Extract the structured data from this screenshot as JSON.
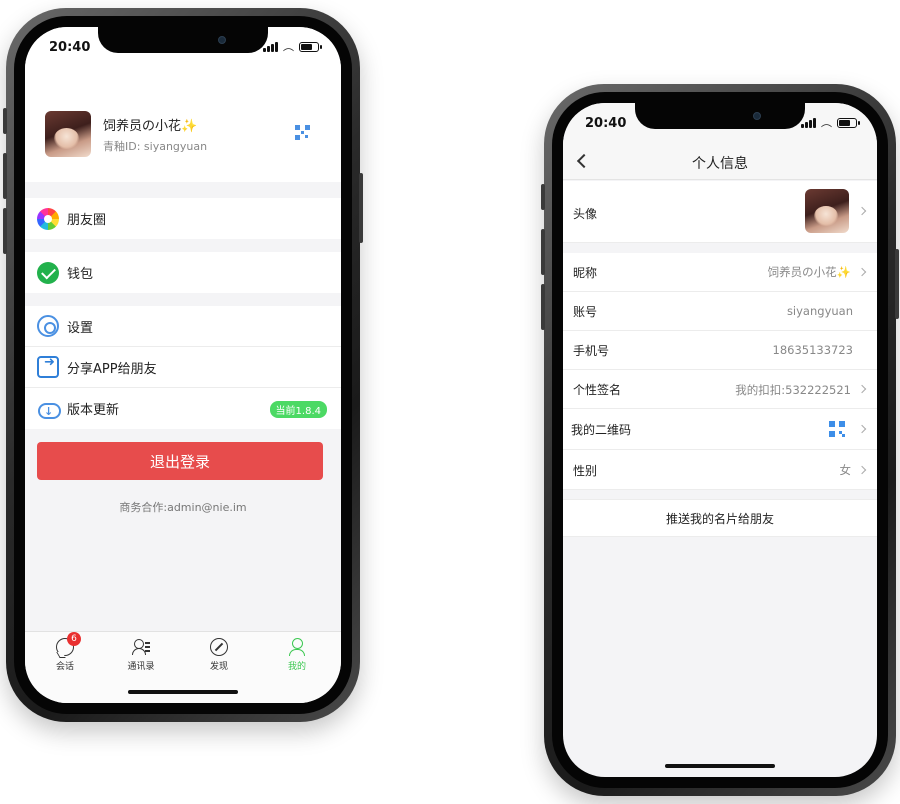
{
  "left_phone": {
    "status": {
      "time": "20:40"
    },
    "profile": {
      "nickname": "饲养员の小花✨",
      "account_id": "青釉ID: siyangyuan"
    },
    "menu": {
      "moments": "朋友圈",
      "wallet": "钱包",
      "settings": "设置",
      "share_app": "分享APP给朋友",
      "version_update": "版本更新",
      "version_badge": "当前1.8.4"
    },
    "logout_label": "退出登录",
    "business_contact": "商务合作:admin@nie.im",
    "tabs": {
      "chats": "会话",
      "chats_badge": "6",
      "contacts": "通讯录",
      "discover": "发现",
      "me": "我的"
    },
    "colors": {
      "accent": "#3cc851",
      "logout": "#e74c4c",
      "badge": "#4cd964"
    }
  },
  "right_phone": {
    "status": {
      "time": "20:40"
    },
    "nav_title": "个人信息",
    "rows": {
      "avatar_label": "头像",
      "nickname_label": "昵称",
      "nickname_value": "饲养员の小花✨",
      "account_label": "账号",
      "account_value": "siyangyuan",
      "phone_label": "手机号",
      "phone_value": "18635133723",
      "signature_label": "个性签名",
      "signature_value": "我的扣扣:532222521",
      "qrcode_label": "我的二维码",
      "gender_label": "性别",
      "gender_value": "女"
    },
    "push_card_label": "推送我的名片给朋友"
  }
}
